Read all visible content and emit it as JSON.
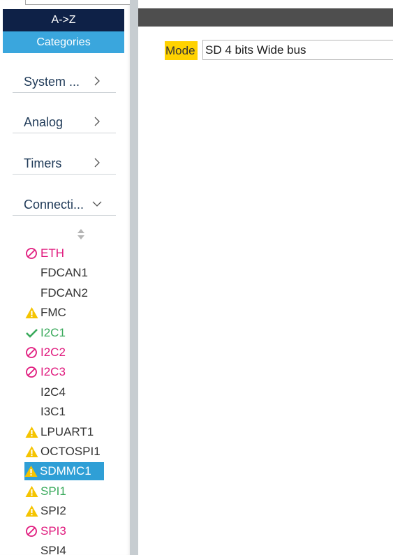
{
  "sidebar": {
    "az_label": "A->Z",
    "categories_label": "Categories",
    "categories": [
      {
        "label": "System ...",
        "expanded": false
      },
      {
        "label": "Analog",
        "expanded": false
      },
      {
        "label": "Timers",
        "expanded": false
      },
      {
        "label": "Connecti...",
        "expanded": true
      }
    ],
    "peripherals": [
      {
        "label": "ETH",
        "status": "disabled"
      },
      {
        "label": "FDCAN1",
        "status": "none"
      },
      {
        "label": "FDCAN2",
        "status": "none"
      },
      {
        "label": "FMC",
        "status": "warning"
      },
      {
        "label": "I2C1",
        "status": "ok"
      },
      {
        "label": "I2C2",
        "status": "disabled"
      },
      {
        "label": "I2C3",
        "status": "disabled"
      },
      {
        "label": "I2C4",
        "status": "none"
      },
      {
        "label": "I3C1",
        "status": "none"
      },
      {
        "label": "LPUART1",
        "status": "warning"
      },
      {
        "label": "OCTOSPI1",
        "status": "warning"
      },
      {
        "label": "SDMMC1",
        "status": "warning",
        "selected": true
      },
      {
        "label": "SPI1",
        "status": "warning-ok"
      },
      {
        "label": "SPI2",
        "status": "warning"
      },
      {
        "label": "SPI3",
        "status": "disabled"
      },
      {
        "label": "SPI4",
        "status": "none"
      }
    ]
  },
  "mode": {
    "label": "Mode",
    "value": "SD 4 bits Wide bus"
  },
  "colors": {
    "disabled": "#e0197d",
    "ok": "#3aaa5c",
    "warning": "#f5c400",
    "normal": "#333333",
    "selected_bg": "#2f9fd6",
    "dark_nav": "#0e2147",
    "accent": "#3aa6dd"
  }
}
